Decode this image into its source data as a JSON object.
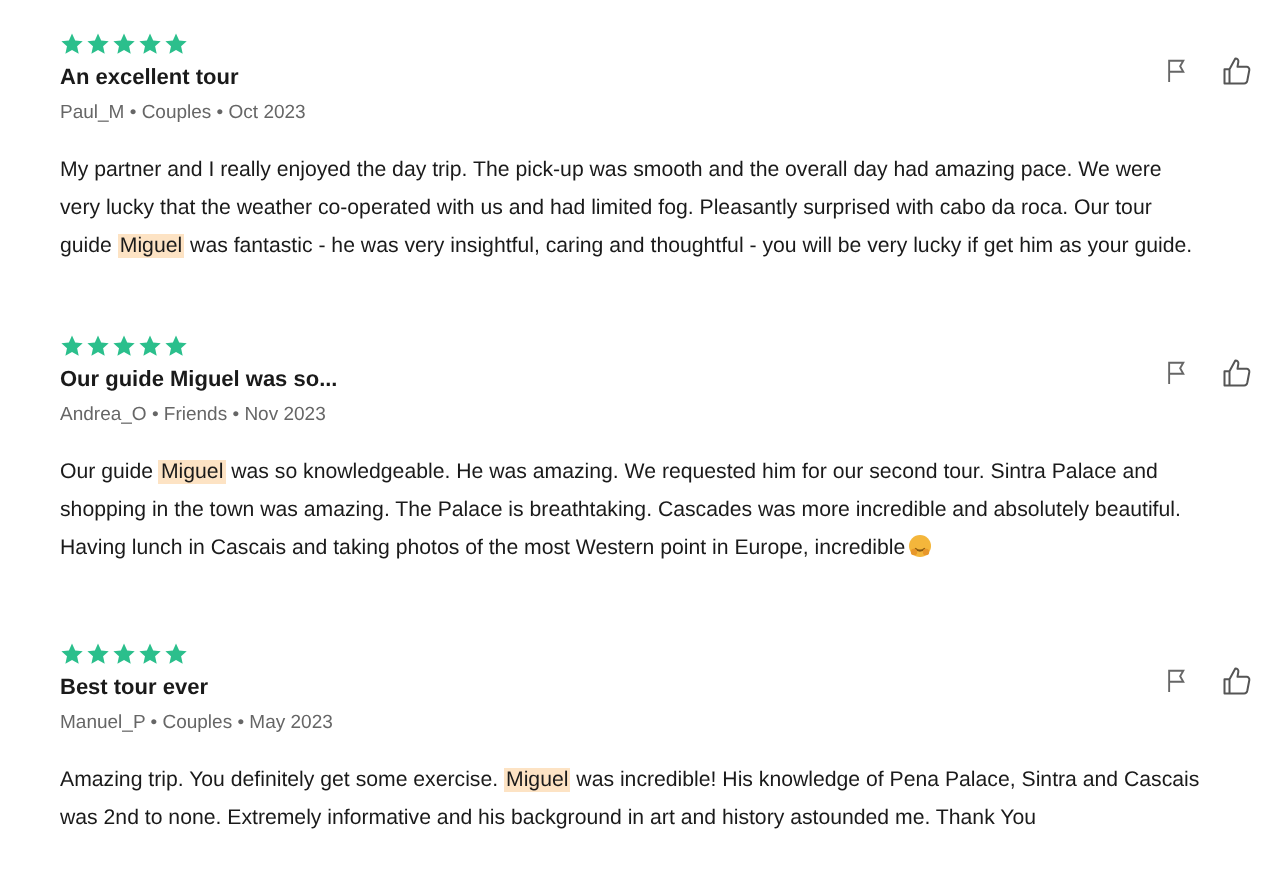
{
  "reviews": [
    {
      "stars": 5,
      "title": "An excellent tour",
      "meta": "Paul_M • Couples • Oct 2023",
      "emoji": false,
      "body": [
        {
          "text": "My partner and I really enjoyed the day trip. The pick-up was smooth and the overall day had amazing pace. We were very lucky that the weather co-operated with us and had limited fog. Pleasantly surprised with cabo da roca. Our tour guide ",
          "highlighted": false
        },
        {
          "text": "Miguel",
          "highlighted": true
        },
        {
          "text": " was fantastic - he was very insightful, caring and thoughtful - you will be very lucky if get him as your guide.",
          "highlighted": false
        }
      ]
    },
    {
      "stars": 5,
      "title": "Our guide Miguel was so...",
      "meta": "Andrea_O • Friends • Nov 2023",
      "emoji": true,
      "body": [
        {
          "text": "Our guide ",
          "highlighted": false
        },
        {
          "text": "Miguel",
          "highlighted": true
        },
        {
          "text": " was so knowledgeable. He was amazing. We requested him for our second tour. Sintra Palace and shopping in the town was amazing. The Palace is breathtaking. Cascades was more incredible and absolutely beautiful. Having lunch in Cascais and taking photos of the most Western point in Europe, incredible",
          "highlighted": false
        }
      ]
    },
    {
      "stars": 5,
      "title": "Best tour ever",
      "meta": "Manuel_P • Couples • May 2023",
      "emoji": false,
      "body": [
        {
          "text": "Amazing trip. You definitely get some exercise. ",
          "highlighted": false
        },
        {
          "text": "Miguel",
          "highlighted": true
        },
        {
          "text": " was incredible! His knowledge of Pena Palace, Sintra and Cascais was 2nd to none. Extremely informative and his background in art and history astounded me. Thank You",
          "highlighted": false
        }
      ]
    }
  ]
}
